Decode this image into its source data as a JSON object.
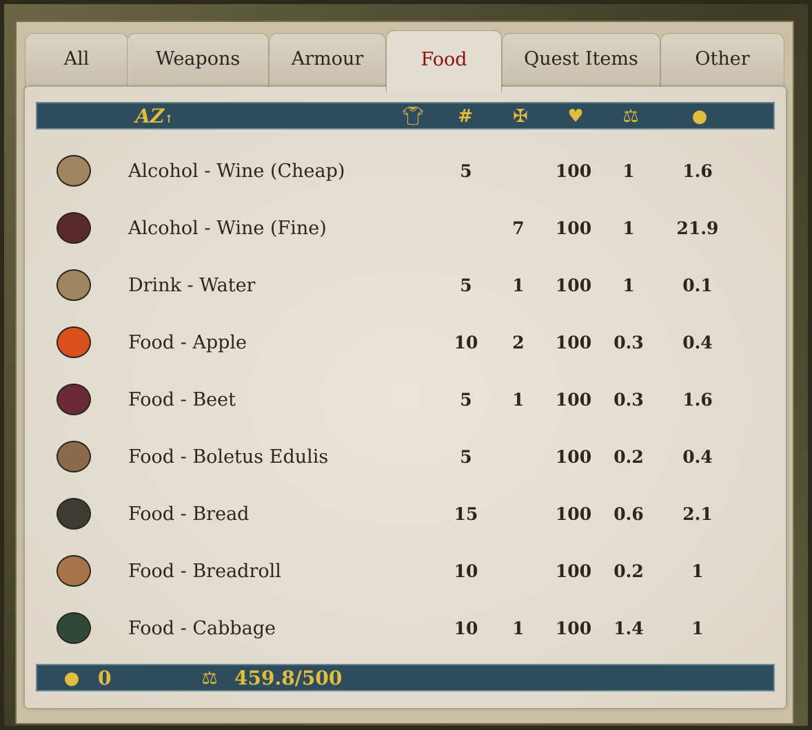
{
  "tabs": [
    {
      "label": "All"
    },
    {
      "label": "Weapons"
    },
    {
      "label": "Armour"
    },
    {
      "label": "Food"
    },
    {
      "label": "Quest Items"
    },
    {
      "label": "Other"
    }
  ],
  "active_tab": "Food",
  "colors": {
    "active_tab": "#8c1010",
    "bar": "#2f4c5e",
    "icon_gold": "#e0bd3c",
    "parchment": "#e6e1d6"
  },
  "header": {
    "sort_label": "AZ",
    "columns": [
      "clothing-icon",
      "#",
      "cross-icon",
      "broken-heart-icon",
      "scales-icon",
      "coins-icon"
    ],
    "amount_symbol": "#"
  },
  "items": [
    {
      "name": "Alcohol - Wine (Cheap)",
      "icon": "wine-skin",
      "c1": "5",
      "c2": "",
      "c3": "100",
      "c4": "1",
      "c5": "1.6"
    },
    {
      "name": "Alcohol - Wine (Fine)",
      "icon": "wine-skin-dark",
      "c1": "",
      "c2": "7",
      "c3": "100",
      "c4": "1",
      "c5": "21.9"
    },
    {
      "name": "Drink - Water",
      "icon": "water-skin",
      "c1": "5",
      "c2": "1",
      "c3": "100",
      "c4": "1",
      "c5": "0.1"
    },
    {
      "name": "Food - Apple",
      "icon": "apple",
      "c1": "10",
      "c2": "2",
      "c3": "100",
      "c4": "0.3",
      "c5": "0.4"
    },
    {
      "name": "Food - Beet",
      "icon": "beet",
      "c1": "5",
      "c2": "1",
      "c3": "100",
      "c4": "0.3",
      "c5": "1.6"
    },
    {
      "name": "Food - Boletus Edulis",
      "icon": "mushroom",
      "c1": "5",
      "c2": "",
      "c3": "100",
      "c4": "0.2",
      "c5": "0.4"
    },
    {
      "name": "Food - Bread",
      "icon": "bread",
      "c1": "15",
      "c2": "",
      "c3": "100",
      "c4": "0.6",
      "c5": "2.1"
    },
    {
      "name": "Food - Breadroll",
      "icon": "breadroll",
      "c1": "10",
      "c2": "",
      "c3": "100",
      "c4": "0.2",
      "c5": "1"
    },
    {
      "name": "Food - Cabbage",
      "icon": "cabbage",
      "c1": "10",
      "c2": "1",
      "c3": "100",
      "c4": "1.4",
      "c5": "1"
    }
  ],
  "footer": {
    "money": "0",
    "weight": "459.8/500"
  }
}
